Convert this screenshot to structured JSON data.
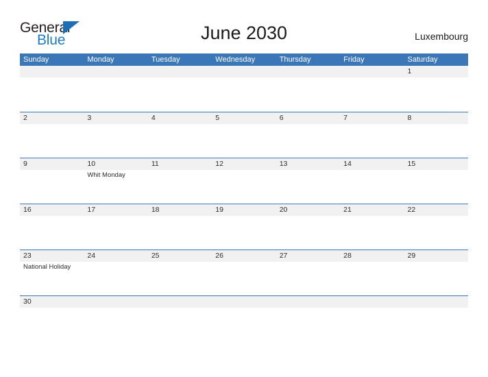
{
  "brand": {
    "name_part1": "General",
    "name_part2": "Blue",
    "flag_icon": "triangle-flag-icon",
    "accent_color": "#1f7bc1"
  },
  "header": {
    "title": "June 2030",
    "location": "Luxembourg"
  },
  "colors": {
    "header_blue": "#3b77b8",
    "band_gray": "#f1f1f1",
    "row_line": "#3b77b8",
    "text": "#2b2b2b"
  },
  "calendar": {
    "month": "June",
    "year": "2030",
    "day_headers": [
      "Sunday",
      "Monday",
      "Tuesday",
      "Wednesday",
      "Thursday",
      "Friday",
      "Saturday"
    ],
    "weeks": [
      [
        {
          "date": "",
          "event": ""
        },
        {
          "date": "",
          "event": ""
        },
        {
          "date": "",
          "event": ""
        },
        {
          "date": "",
          "event": ""
        },
        {
          "date": "",
          "event": ""
        },
        {
          "date": "",
          "event": ""
        },
        {
          "date": "1",
          "event": ""
        }
      ],
      [
        {
          "date": "2",
          "event": ""
        },
        {
          "date": "3",
          "event": ""
        },
        {
          "date": "4",
          "event": ""
        },
        {
          "date": "5",
          "event": ""
        },
        {
          "date": "6",
          "event": ""
        },
        {
          "date": "7",
          "event": ""
        },
        {
          "date": "8",
          "event": ""
        }
      ],
      [
        {
          "date": "9",
          "event": ""
        },
        {
          "date": "10",
          "event": "Whit Monday"
        },
        {
          "date": "11",
          "event": ""
        },
        {
          "date": "12",
          "event": ""
        },
        {
          "date": "13",
          "event": ""
        },
        {
          "date": "14",
          "event": ""
        },
        {
          "date": "15",
          "event": ""
        }
      ],
      [
        {
          "date": "16",
          "event": ""
        },
        {
          "date": "17",
          "event": ""
        },
        {
          "date": "18",
          "event": ""
        },
        {
          "date": "19",
          "event": ""
        },
        {
          "date": "20",
          "event": ""
        },
        {
          "date": "21",
          "event": ""
        },
        {
          "date": "22",
          "event": ""
        }
      ],
      [
        {
          "date": "23",
          "event": "National Holiday"
        },
        {
          "date": "24",
          "event": ""
        },
        {
          "date": "25",
          "event": ""
        },
        {
          "date": "26",
          "event": ""
        },
        {
          "date": "27",
          "event": ""
        },
        {
          "date": "28",
          "event": ""
        },
        {
          "date": "29",
          "event": ""
        }
      ],
      [
        {
          "date": "30",
          "event": ""
        },
        {
          "date": "",
          "event": ""
        },
        {
          "date": "",
          "event": ""
        },
        {
          "date": "",
          "event": ""
        },
        {
          "date": "",
          "event": ""
        },
        {
          "date": "",
          "event": ""
        },
        {
          "date": "",
          "event": ""
        }
      ]
    ]
  }
}
